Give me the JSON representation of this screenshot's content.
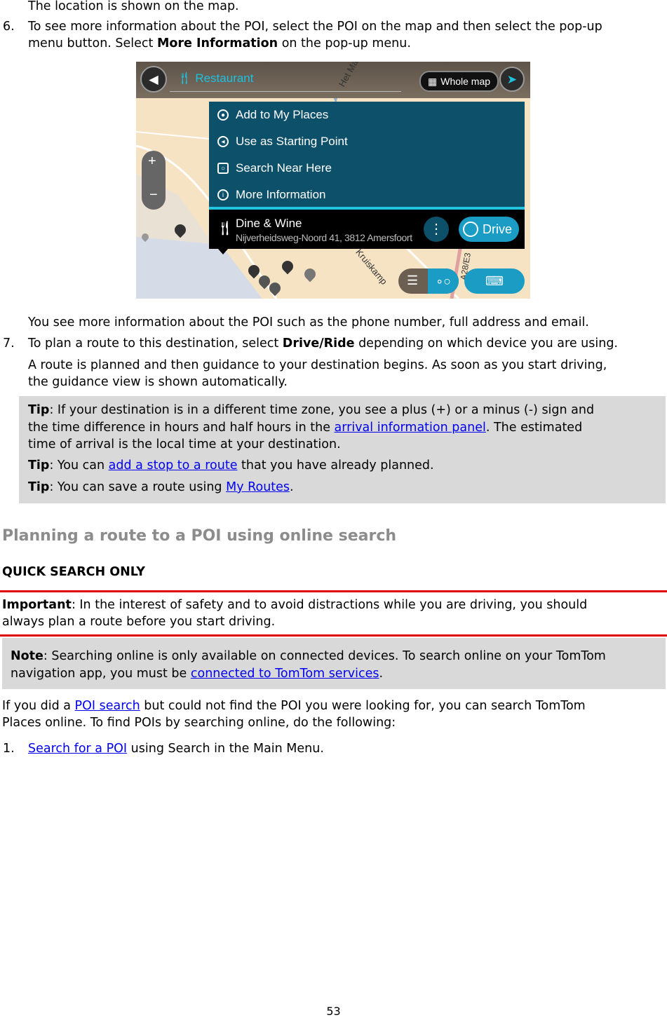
{
  "steps_before": {
    "location_line": "The location is shown on the map.",
    "step6": {
      "number": "6.",
      "text_a": "To see more information about the POI, select the POI on the map and then select the pop-up",
      "text_b": "menu button. Select ",
      "bold": "More Information",
      "text_c": " on the pop-up menu."
    }
  },
  "map_screenshot": {
    "search_text": "Restaurant",
    "whole_map_label": "Whole map",
    "street_labels": [
      "Het Mas",
      "Kruiskamp",
      "A28/E3"
    ],
    "menu_items": [
      {
        "label": "Add to My Places",
        "icon": "place-pin-icon"
      },
      {
        "label": "Use as Starting Point",
        "icon": "navigate-arrow-icon"
      },
      {
        "label": "Search Near Here",
        "icon": "search-near-icon"
      },
      {
        "label": "More Information",
        "icon": "info-icon"
      }
    ],
    "poi_name": "Dine & Wine",
    "poi_address": "Nijverheidsweg-Noord 41, 3812 Amersfoort",
    "drive_label": "Drive",
    "colors": {
      "menu_bg": "#0d5069",
      "accent": "#22c4e0",
      "drive_button": "#1a9cc4"
    }
  },
  "after_step6": "You see more information about the POI such as the phone number, full address and email.",
  "step7": {
    "number": "7.",
    "text_a": "To plan a route to this destination, select ",
    "bold": "Drive/Ride",
    "text_b": " depending on which device you are using."
  },
  "route_planned": {
    "line1": "A route is planned and then guidance to your destination begins. As soon as you start driving,",
    "line2": "the guidance view is shown automatically."
  },
  "tips": {
    "label": "Tip",
    "tip1_a": ": If your destination is in a different time zone, you see a plus (+) or a minus (-) sign and",
    "tip1_b": "the time difference in hours and half hours in the ",
    "tip1_link": "arrival information panel",
    "tip1_c": ". The estimated",
    "tip1_d": "time of arrival is the local time at your destination.",
    "tip2_a": ": You can ",
    "tip2_link": "add a stop to a route",
    "tip2_b": " that you have already planned.",
    "tip3_a": ": You can save a route using ",
    "tip3_link": "My Routes",
    "tip3_b": "."
  },
  "section_heading": "Planning a route to a POI using online search",
  "quick_search": "QUICK SEARCH ONLY",
  "important": {
    "label": "Important",
    "line1": ": In the interest of safety and to avoid distractions while you are driving, you should",
    "line2": "always plan a route before you start driving."
  },
  "note": {
    "label": "Note",
    "line1": ": Searching online is only available on connected devices. To search online on your TomTom",
    "line2_a": "navigation app, you must be ",
    "link": "connected to TomTom services",
    "line2_b": "."
  },
  "intro": {
    "a": "If you did a ",
    "link": "POI search",
    "b": " but could not find the POI you were looking for, you can search TomTom",
    "line2": "Places online. To find POIs by searching online, do the following:"
  },
  "step1": {
    "number": "1.",
    "link": "Search for a POI",
    "text": " using Search in the Main Menu."
  },
  "page_number": "53",
  "colors": {
    "link": "#0000ee",
    "tip_bg": "#d9d9d9",
    "important_rule": "#e00000",
    "heading": "#8c8c8c"
  }
}
